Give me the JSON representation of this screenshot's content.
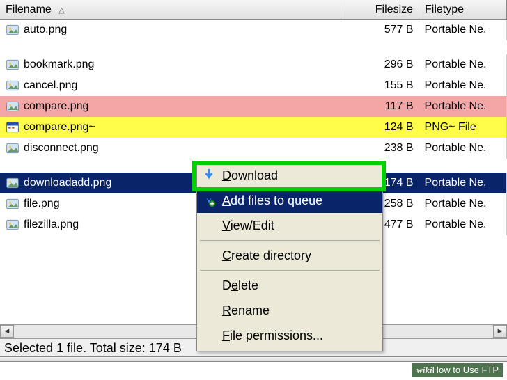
{
  "columns": {
    "filename": "Filename",
    "filesize": "Filesize",
    "filetype": "Filetype"
  },
  "rows": [
    {
      "name": "auto.png",
      "size": "577 B",
      "type": "Portable Ne.",
      "state": ""
    },
    {
      "name": "",
      "size": "",
      "type": "",
      "state": "gap"
    },
    {
      "name": "bookmark.png",
      "size": "296 B",
      "type": "Portable Ne.",
      "state": ""
    },
    {
      "name": "cancel.png",
      "size": "155 B",
      "type": "Portable Ne.",
      "state": ""
    },
    {
      "name": "compare.png",
      "size": "117 B",
      "type": "Portable Ne.",
      "state": "red"
    },
    {
      "name": "compare.png~",
      "size": "124 B",
      "type": "PNG~ File",
      "state": "yellow"
    },
    {
      "name": "disconnect.png",
      "size": "238 B",
      "type": "Portable Ne.",
      "state": ""
    },
    {
      "name": "",
      "size": "",
      "type": "",
      "state": "gap"
    },
    {
      "name": "downloadadd.png",
      "size": "174 B",
      "type": "Portable Ne.",
      "state": "selected"
    },
    {
      "name": "file.png",
      "size": "258 B",
      "type": "Portable Ne.",
      "state": ""
    },
    {
      "name": "filezilla.png",
      "size": "477 B",
      "type": "Portable Ne.",
      "state": ""
    }
  ],
  "status": "Selected 1 file. Total size: 174 B",
  "context_menu": {
    "download": "Download",
    "add_queue": "Add files to queue",
    "view_edit": "View/Edit",
    "create_dir": "Create directory",
    "delete": "Delete",
    "rename": "Rename",
    "permissions": "File permissions..."
  },
  "watermark": {
    "brand": "wiki",
    "suffix": "How to Use FTP"
  }
}
